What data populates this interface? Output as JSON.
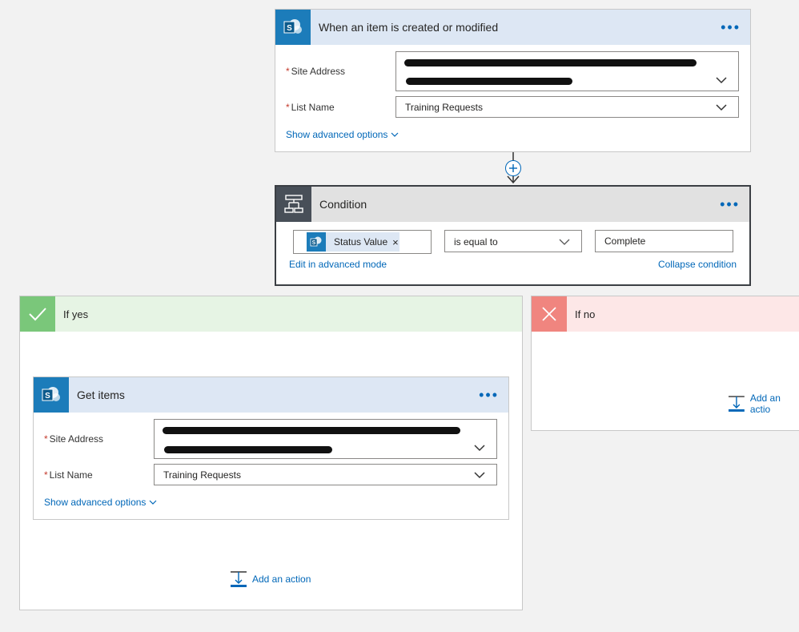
{
  "trigger": {
    "title": "When an item is created or modified",
    "menu_icon": "ellipsis-icon",
    "site_address_label": "Site Address",
    "list_name_label": "List Name",
    "list_name_value": "Training Requests",
    "show_advanced": "Show advanced options"
  },
  "condition": {
    "title": "Condition",
    "token_label": "Status Value",
    "token_remove": "×",
    "operator": "is equal to",
    "value": "Complete",
    "edit_advanced": "Edit in advanced mode",
    "collapse": "Collapse condition"
  },
  "if_yes": {
    "title": "If yes",
    "color": "#e6f4e4",
    "icon_color": "#7ac77a",
    "get_items": {
      "title": "Get items",
      "site_address_label": "Site Address",
      "list_name_label": "List Name",
      "list_name_value": "Training Requests",
      "show_advanced": "Show advanced options"
    },
    "add_action": "Add an action"
  },
  "if_no": {
    "title": "If no",
    "color": "#fde7e7",
    "icon_color": "#f0857f",
    "add_action": "Add an actio"
  },
  "colors": {
    "accent": "#0067b8",
    "sharepoint": "#1c7cba",
    "condition_header": "#e1e1e1",
    "condition_icon_bg": "#484f58"
  }
}
